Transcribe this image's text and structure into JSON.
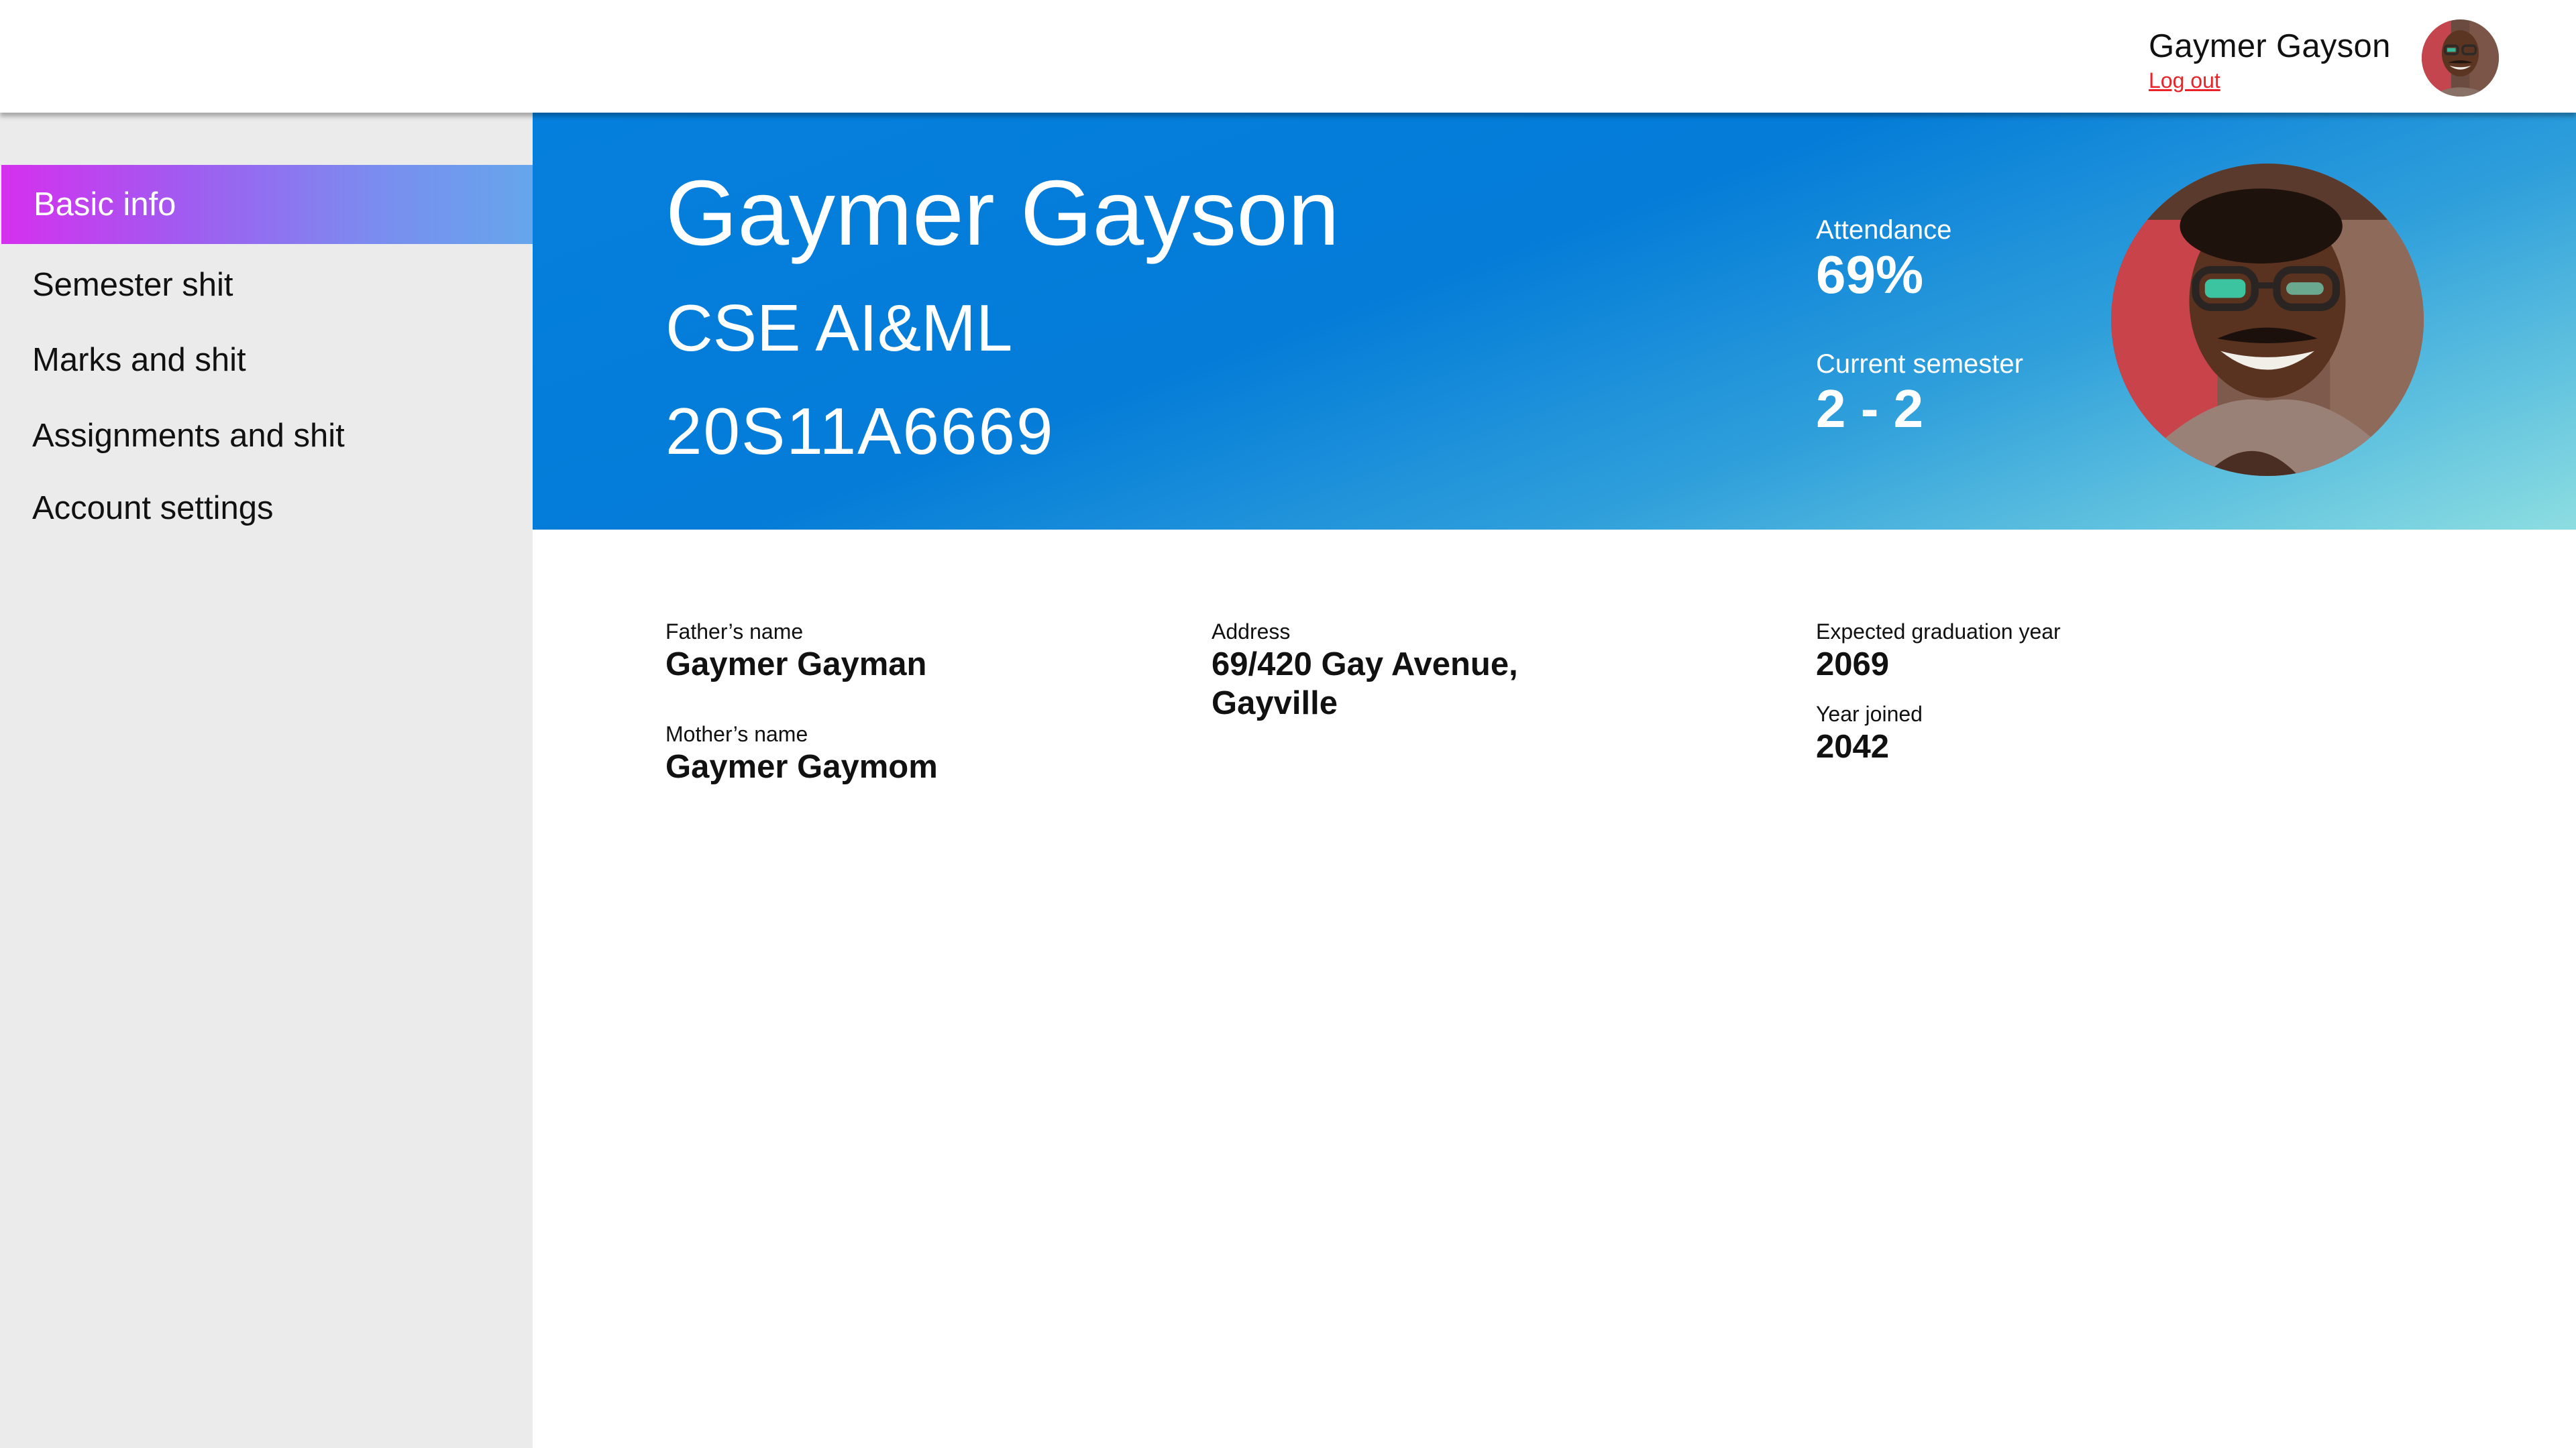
{
  "header": {
    "user_name": "Gaymer Gayson",
    "logout_label": "Log out"
  },
  "sidebar": {
    "items": [
      {
        "label": "Basic info",
        "active": true
      },
      {
        "label": "Semester shit",
        "active": false
      },
      {
        "label": "Marks and shit",
        "active": false
      },
      {
        "label": "Assignments and shit",
        "active": false
      },
      {
        "label": "Account settings",
        "active": false
      }
    ]
  },
  "profile": {
    "name": "Gaymer Gayson",
    "department": "CSE AI&ML",
    "roll_number": "20S11A6669",
    "attendance_label": "Attendance",
    "attendance_value": "69%",
    "semester_label": "Current semester",
    "semester_value": "2 - 2"
  },
  "details": {
    "father_label": "Father’s name",
    "father_value": "Gaymer Gayman",
    "mother_label": "Mother’s name",
    "mother_value": "Gaymer Gaymom",
    "address_label": "Address",
    "address_line1": "69/420 Gay Avenue,",
    "address_line2": "Gayville",
    "graduation_label": "Expected graduation year",
    "graduation_value": "2069",
    "joined_label": "Year joined",
    "joined_value": "2042"
  },
  "colors": {
    "active_gradient_start": "#d530ee",
    "active_gradient_end": "#65a6ec",
    "hero_blue": "#047cd8",
    "hero_cyan": "#8cdde0",
    "logout_red": "#e8232a",
    "sidebar_bg": "#ebebeb"
  }
}
